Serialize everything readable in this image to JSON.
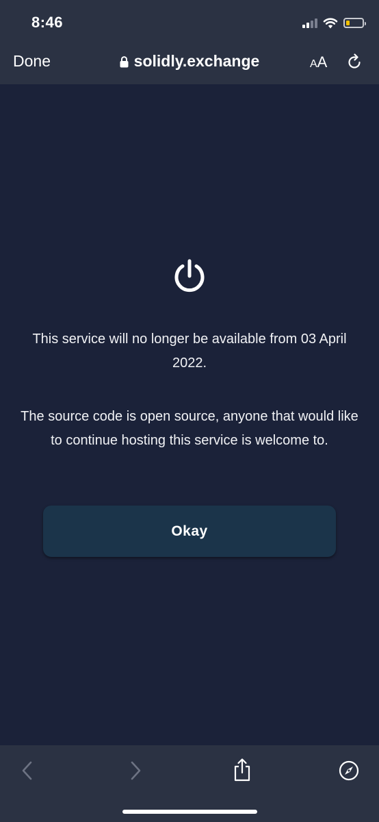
{
  "status_bar": {
    "time": "8:46",
    "icons": [
      "cellular-signal-icon",
      "wifi-icon",
      "battery-icon"
    ],
    "battery_color": "#f2c100"
  },
  "browser": {
    "done_label": "Done",
    "url": "solidly.exchange",
    "text_size_label_small": "A",
    "text_size_label_large": "A",
    "icons": [
      "lock-icon",
      "reload-icon"
    ]
  },
  "content": {
    "icon": "power-icon",
    "message_1": "This service will no longer be available from 03 April 2022.",
    "message_2": "The source code is open source, anyone that would like to continue hosting this service is welcome to.",
    "okay_label": "Okay"
  },
  "toolbar": {
    "icons": [
      "back-arrow-icon",
      "forward-arrow-icon",
      "share-icon",
      "compass-icon"
    ]
  },
  "colors": {
    "page_background": "#1b2239",
    "chrome_background": "#2b3243",
    "button_background": "#1b344a",
    "text": "#ffffff"
  }
}
